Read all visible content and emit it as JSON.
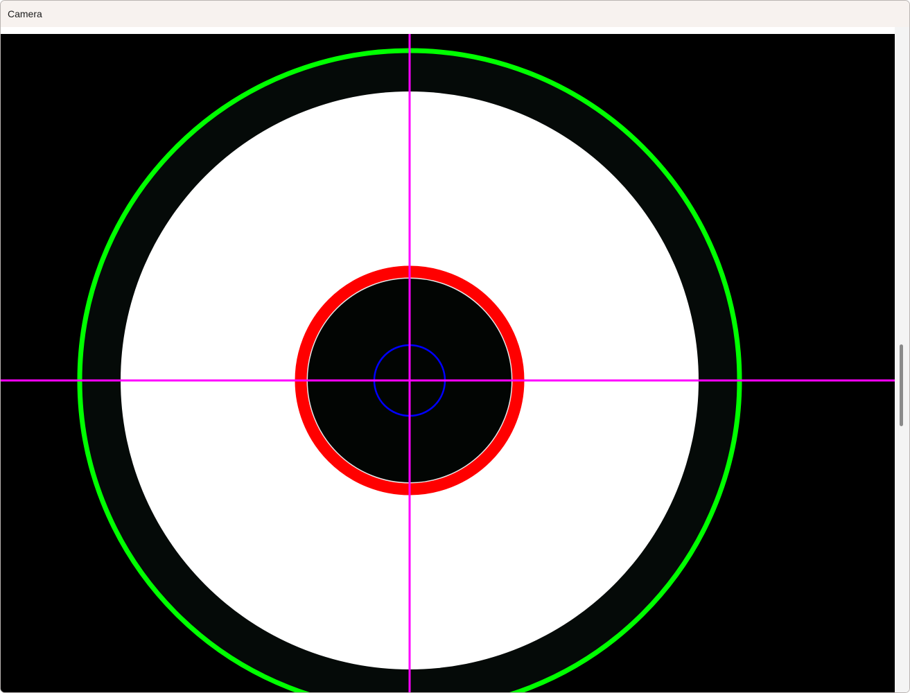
{
  "window": {
    "title": "Camera"
  },
  "colors": {
    "outer_circle": "#00ff00",
    "inner_circle": "#ff0000",
    "center_circle": "#0000ff",
    "crosshair": "#ff00ff",
    "target_white": "#ffffff",
    "background": "#000000"
  },
  "icons": {
    "crosshair": "crosshair-icon"
  }
}
